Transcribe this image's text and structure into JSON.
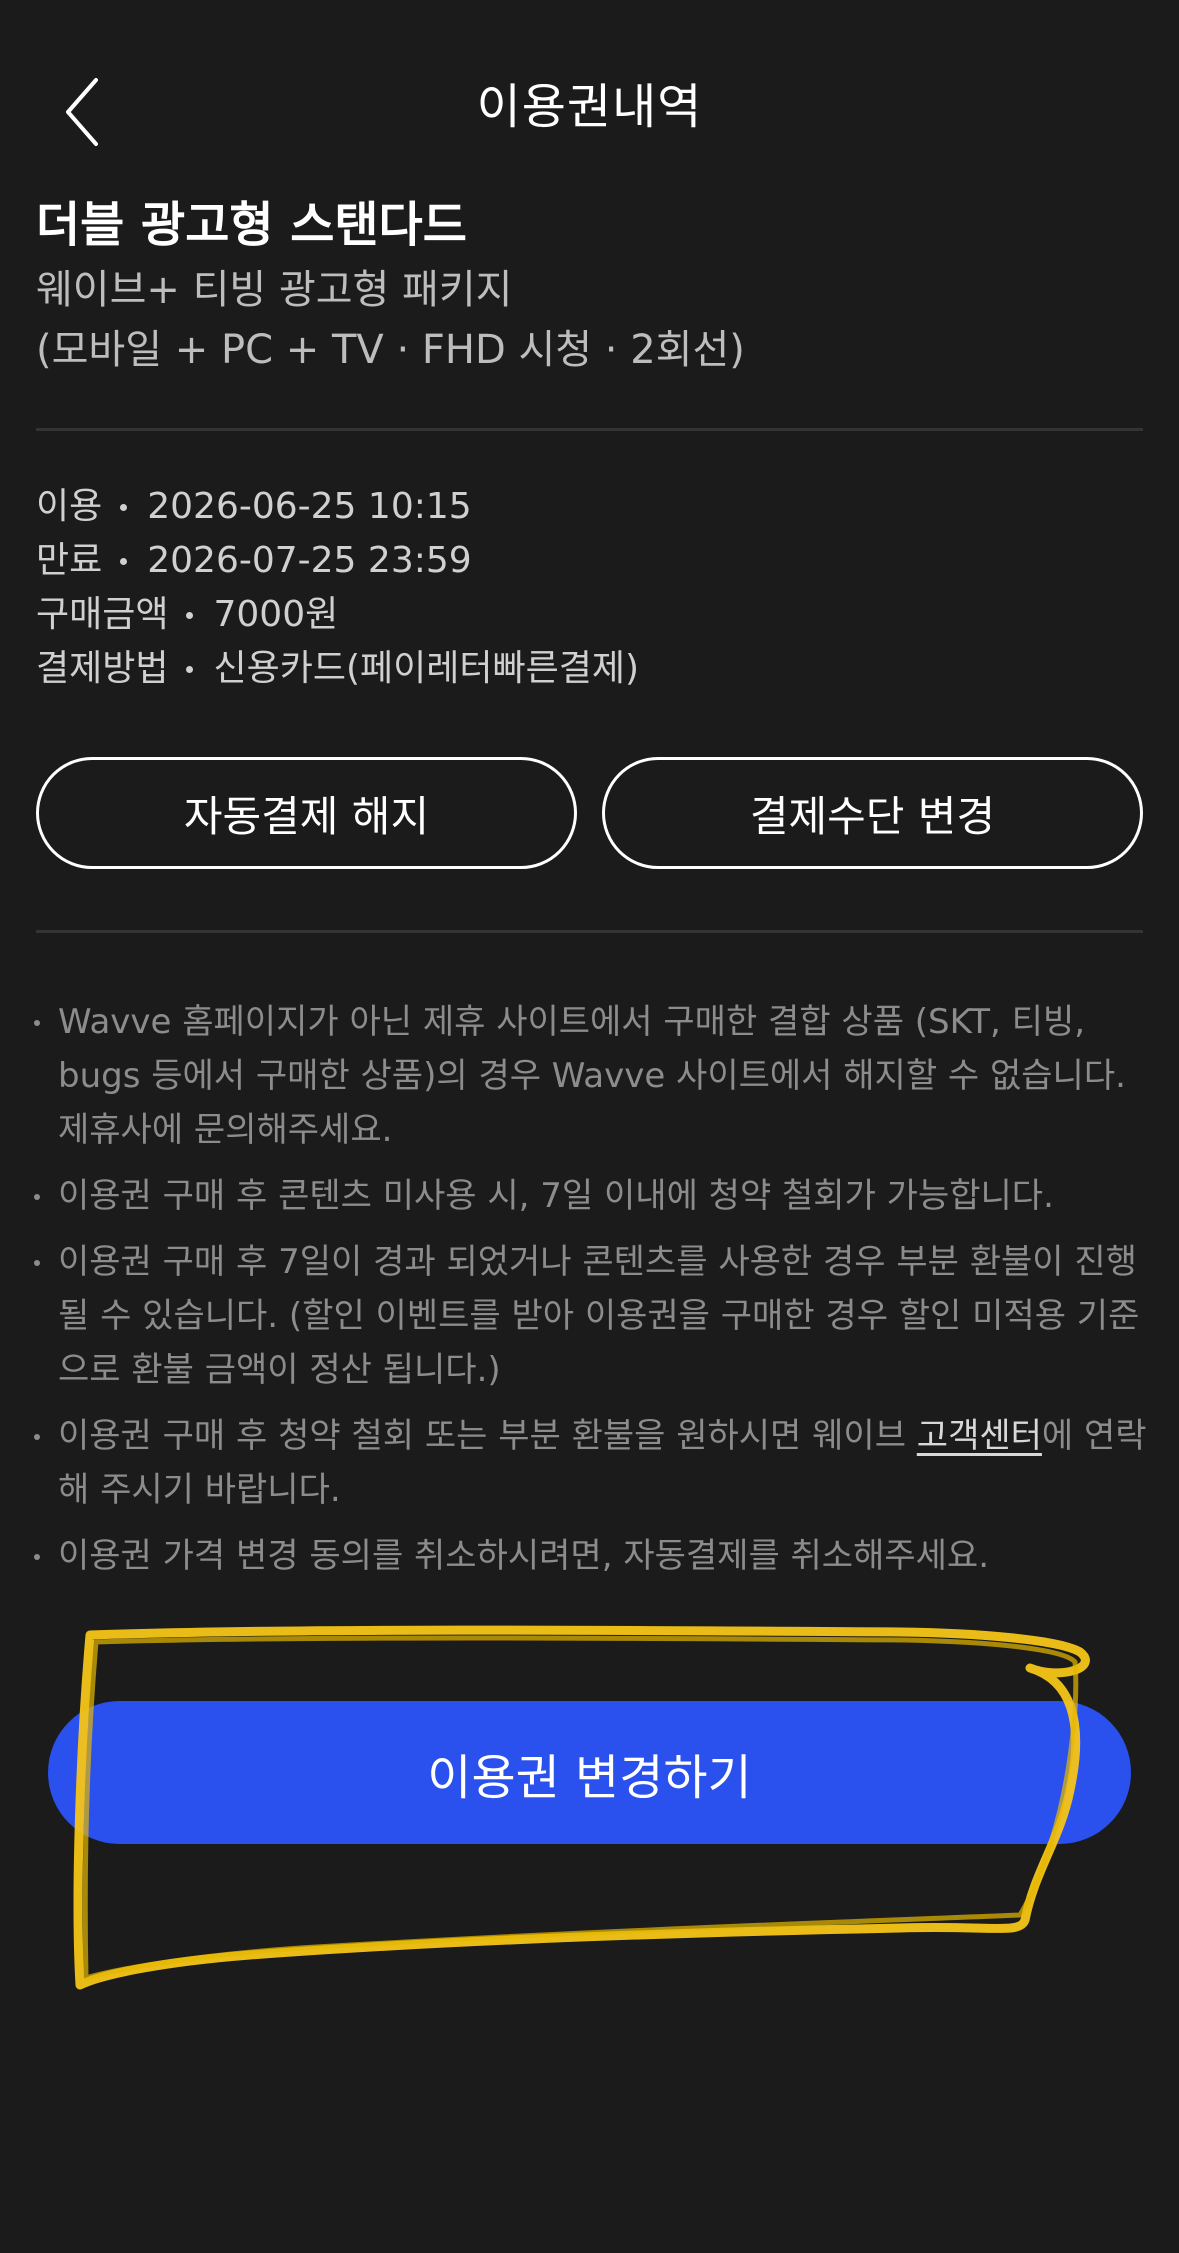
{
  "header": {
    "title": "이용권내역"
  },
  "product": {
    "name": "더블 광고형 스탠다드",
    "subtitle": "웨이브+ 티빙 광고형 패키지",
    "spec": "(모바일 + PC + TV · FHD 시청 · 2회선)"
  },
  "details": [
    {
      "label": "이용",
      "value": "2026-06-25 10:15"
    },
    {
      "label": "만료",
      "value": "2026-07-25 23:59"
    },
    {
      "label": "구매금액",
      "value": "7000원"
    },
    {
      "label": "결제방법",
      "value": "신용카드(페이레터빠른결제)"
    }
  ],
  "buttons": {
    "cancel_autopay": "자동결제 해지",
    "change_payment": "결제수단 변경",
    "change_pass": "이용권 변경하기"
  },
  "notices": [
    "Wavve 홈페이지가 아닌 제휴 사이트에서 구매한 결합 상품 (SKT, 티빙, bugs 등에서 구매한 상품)의 경우 Wavve 사이트에서 해지할 수 없습니다. 제휴사에 문의해주세요.",
    "이용권 구매 후 콘텐츠 미사용 시, 7일 이내에 청약 철회가 가능합니다.",
    "이용권 구매 후 7일이 경과 되었거나 콘텐츠를 사용한 경우 부분 환불이 진행될 수 있습니다. (할인 이벤트를 받아 이용권을 구매한 경우 할인 미적용 기준으로 환불 금액이 정산 됩니다.)",
    "이용권 가격 변경 동의를 취소하시려면, 자동결제를 취소해주세요."
  ],
  "notice_refund": {
    "before": "이용권 구매 후 청약 철회 또는 부분 환불을 원하시면 웨이브 ",
    "link": "고객센터",
    "after": "에 연락해 주시기 바랍니다."
  },
  "colors": {
    "background": "#1b1b1b",
    "primary": "#2a50ed",
    "highlight": "#f5c518",
    "muted_text": "#8c8c8c"
  },
  "icons": {
    "back": "chevron-left-icon"
  }
}
